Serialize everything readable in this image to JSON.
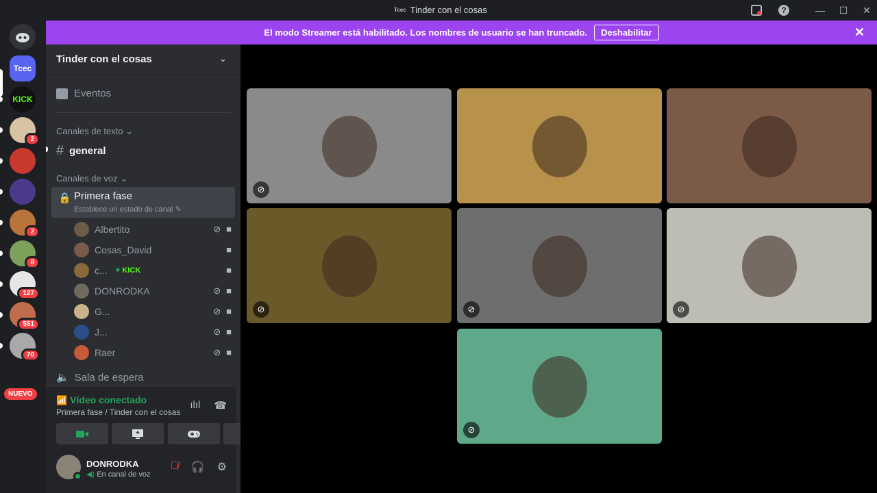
{
  "window": {
    "title": "Tinder con el cosas",
    "title_logo": "Tcec"
  },
  "banner": {
    "text": "El modo Streamer está habilitado. Los nombres de usuario se han truncado.",
    "button": "Deshabilitar"
  },
  "servers": [
    {
      "label": "Tcec",
      "color": "#5865f2",
      "badge": ""
    },
    {
      "label": "KICK",
      "color": "#111111",
      "badge": ""
    },
    {
      "label": "",
      "color": "#d9c3a5",
      "badge": "2"
    },
    {
      "label": "",
      "color": "#c83a2e",
      "badge": ""
    },
    {
      "label": "",
      "color": "#4b3a8c",
      "badge": ""
    },
    {
      "label": "",
      "color": "#b8743a",
      "badge": "2"
    },
    {
      "label": "",
      "color": "#7da05a",
      "badge": "8"
    },
    {
      "label": "",
      "color": "#e6e6e6",
      "badge": "127"
    },
    {
      "label": "",
      "color": "#c06d4e",
      "badge": "551"
    },
    {
      "label": "",
      "color": "#a9a9a9",
      "badge": "70"
    }
  ],
  "nuevo": "NUEVO",
  "sidebar": {
    "server_name": "Tinder con el cosas",
    "events": "Eventos",
    "text_category": "Canales de texto",
    "text_channel": "general",
    "voice_category": "Canales de voz",
    "active_voice": {
      "name": "Primera fase",
      "status": "Establece un estado de canal"
    },
    "members": [
      {
        "name": "Albertito",
        "color": "#6b5b4a",
        "muted": true
      },
      {
        "name": "Cosas_David",
        "color": "#7a5a4a",
        "muted": false
      },
      {
        "name": "c...",
        "color": "#8a6a3a",
        "muted": false,
        "kick": "KICK"
      },
      {
        "name": "DONRODKA",
        "color": "#6e6a5e",
        "muted": true
      },
      {
        "name": "G...",
        "color": "#c9b48a",
        "muted": true
      },
      {
        "name": "J...",
        "color": "#2b4d8a",
        "muted": true
      },
      {
        "name": "Raer",
        "color": "#c65a3a",
        "muted": true
      }
    ],
    "waiting_room": "Sala de espera"
  },
  "voice_panel": {
    "title": "Vídeo conectado",
    "subtitle": "Primera fase / Tinder con el cosas"
  },
  "user": {
    "name": "DONRODKA",
    "status": "En canal de voz"
  },
  "tiles": [
    {
      "bg": "#8a8a8a",
      "muted": true
    },
    {
      "bg": "#b8924a",
      "muted": false
    },
    {
      "bg": "#7b5a48",
      "muted": false
    },
    {
      "bg": "#6a5a2a",
      "muted": true
    },
    {
      "bg": "#6e6e6e",
      "muted": true
    },
    {
      "bg": "#bdbdb5",
      "muted": true
    },
    {
      "bg": "#5fa88a",
      "muted": true
    }
  ]
}
